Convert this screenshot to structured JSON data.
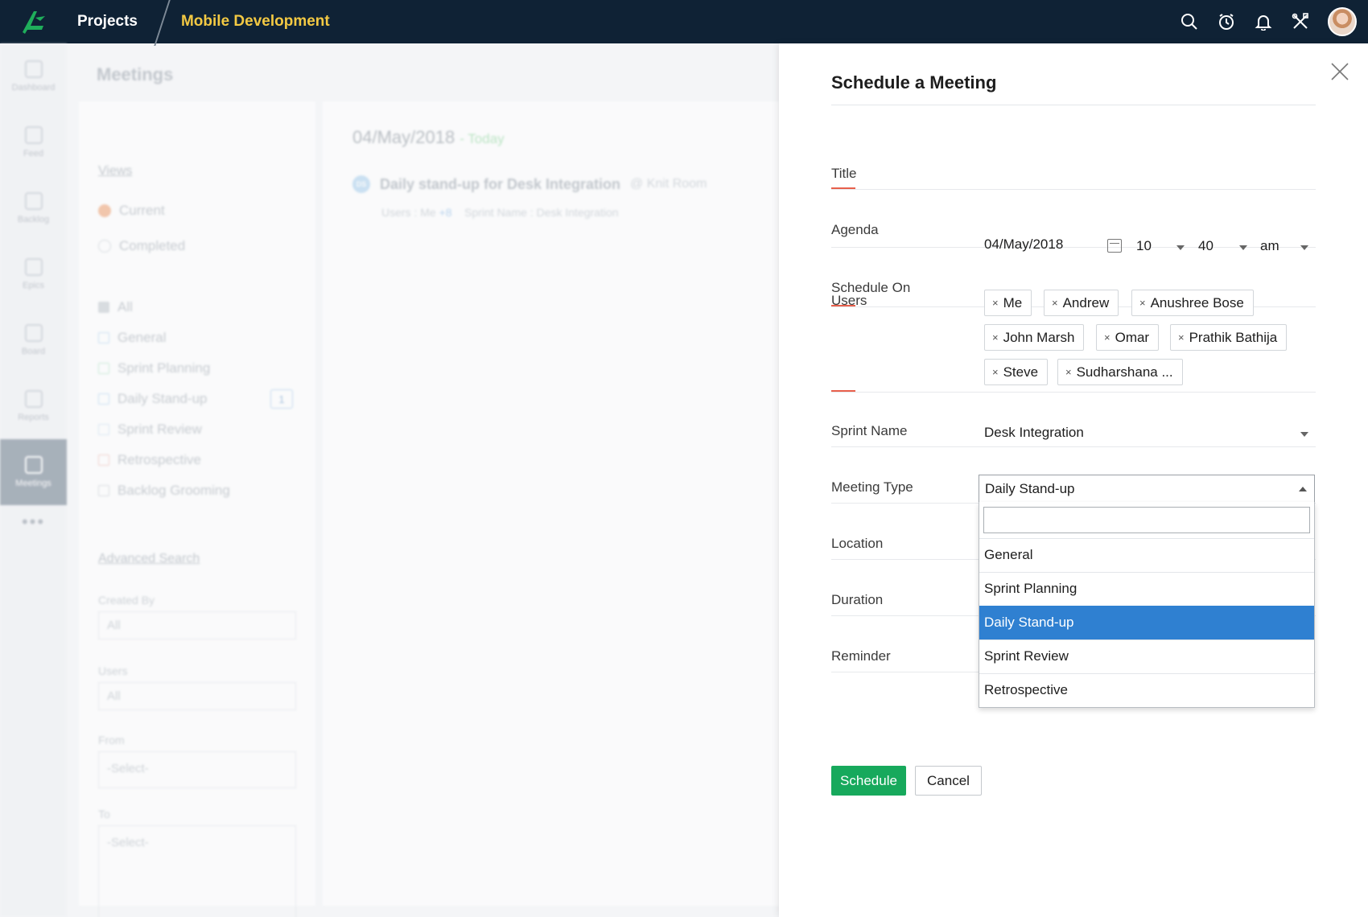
{
  "topbar": {
    "projects_label": "Projects",
    "project_name": "Mobile Development",
    "icons": [
      "search-icon",
      "timer-icon",
      "bell-icon",
      "tools-icon"
    ]
  },
  "leftnav": {
    "items": [
      {
        "label": "Dashboard",
        "icon": "dashboard-icon"
      },
      {
        "label": "Feed",
        "icon": "feed-icon"
      },
      {
        "label": "Backlog",
        "icon": "backlog-icon"
      },
      {
        "label": "Epics",
        "icon": "epics-icon"
      },
      {
        "label": "Board",
        "icon": "board-icon"
      },
      {
        "label": "Reports",
        "icon": "reports-icon"
      },
      {
        "label": "Meetings",
        "icon": "meetings-icon",
        "active": true
      }
    ],
    "more": "•••"
  },
  "meetings": {
    "title": "Meetings",
    "views_link": "Views",
    "view_options": [
      "Current",
      "Completed"
    ],
    "filters": [
      "All",
      "General",
      "Sprint Planning",
      "Daily Stand-up",
      "Sprint Review",
      "Retrospective",
      "Backlog Grooming"
    ],
    "daily_standup_count": "1",
    "advanced_search": "Advanced Search",
    "created_by_label": "Created By",
    "created_by_value": "All",
    "users_label": "Users",
    "users_value": "All",
    "from_label": "From",
    "from_value": "-Select-",
    "to_label": "To",
    "to_value": "-Select-"
  },
  "main": {
    "date": "04/May/2018",
    "today": "- Today",
    "meeting_badge": "DS",
    "meeting_title": "Daily stand-up for Desk Integration",
    "meeting_room": "@ Knit Room",
    "users_prefix": "Users :",
    "users_me": "Me",
    "users_more": "+8",
    "sprint_prefix": "Sprint Name :",
    "sprint_value": "Desk Integration"
  },
  "form": {
    "heading": "Schedule a Meeting",
    "title_label": "Title",
    "agenda_label": "Agenda",
    "schedule_on_label": "Schedule On",
    "schedule_date": "04/May/2018",
    "hour": "10",
    "minute": "40",
    "ampm": "am",
    "users_label": "Users",
    "users": [
      "Me",
      "Andrew",
      "Anushree Bose",
      "John Marsh",
      "Omar",
      "Prathik Bathija",
      "Steve",
      "Sudharshana ..."
    ],
    "tag_remove_glyph": "×",
    "sprint_name_label": "Sprint Name",
    "sprint_name_value": "Desk Integration",
    "meeting_type_label": "Meeting Type",
    "meeting_type_value": "Daily Stand-up",
    "meeting_type_search": "",
    "meeting_type_options": [
      "General",
      "Sprint Planning",
      "Daily Stand-up",
      "Sprint Review",
      "Retrospective"
    ],
    "meeting_type_selected_index": 2,
    "location_label": "Location",
    "duration_label": "Duration",
    "reminder_label": "Reminder",
    "schedule_button": "Schedule",
    "cancel_button": "Cancel"
  },
  "colors": {
    "topbar": "#0f2235",
    "project_name": "#f3c943",
    "accent_underline": "#e8604c",
    "primary_button": "#17a95c",
    "selected_option": "#2f80d1"
  }
}
